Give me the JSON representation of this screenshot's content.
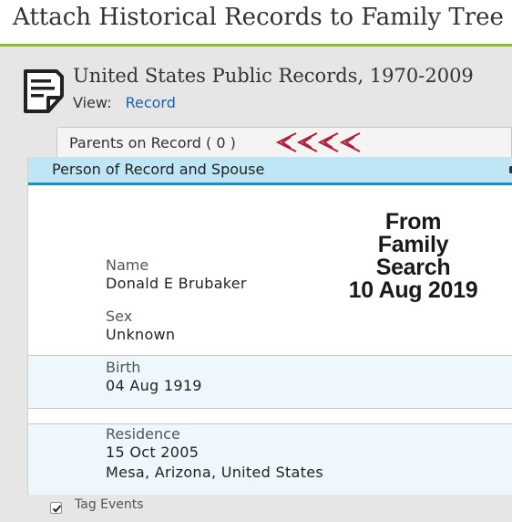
{
  "header": {
    "title": "Attach Historical Records to Family Tree"
  },
  "source": {
    "title": "United States Public Records, 1970-2009",
    "view_label": "View:",
    "view_link": "Record"
  },
  "tab": {
    "label": "Parents on Record  ( 0 )"
  },
  "card": {
    "header": "Person of Record and Spouse",
    "stamp": [
      "From",
      "Family",
      "Search",
      "10 Aug 2019"
    ],
    "name": {
      "label": "Name",
      "value": "Donald E Brubaker"
    },
    "sex": {
      "label": "Sex",
      "value": "Unknown"
    },
    "birth": {
      "label": "Birth",
      "date": "04 Aug 1919"
    },
    "residence": {
      "label": "Residence",
      "date": "15 Oct 2005",
      "place": "Mesa, Arizona, United States"
    }
  },
  "footer": {
    "tag_events_label": "Tag Events",
    "tag_events_checked": true
  },
  "colors": {
    "accent_bar": "#8cba2b",
    "link": "#1a5fb4",
    "card_header_bg": "#bfe6f5",
    "card_header_border": "#1a90c9",
    "annotation_arrows": "#b0203a"
  },
  "icons": [
    "document-icon",
    "arrow-annotation-icon",
    "checkbox-icon"
  ]
}
